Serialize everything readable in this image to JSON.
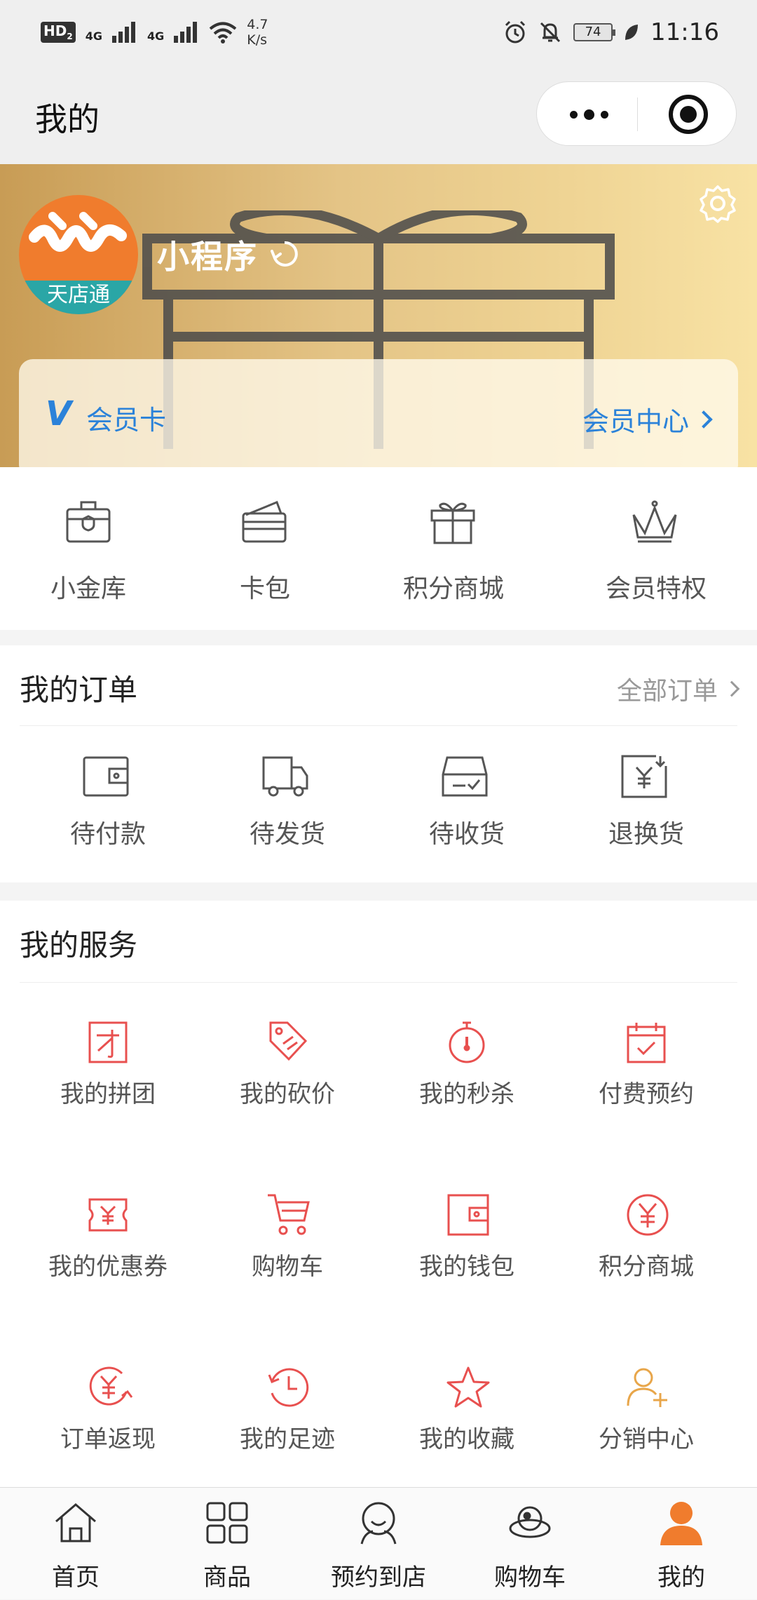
{
  "status_bar": {
    "hd": "HD",
    "sim_index": "2",
    "network_1": "4G",
    "network_2": "4G",
    "speed_value": "4.7",
    "speed_unit": "K/s",
    "battery": "74",
    "time": "11:16"
  },
  "title_bar": {
    "title": "我的"
  },
  "profile": {
    "avatar_brand": "天店通",
    "username": "小程序",
    "member_card_label": "会员卡",
    "member_center_label": "会员中心",
    "colors": {
      "accent_blue": "#2b82d9",
      "banner_gold": "#e4c486"
    }
  },
  "quick_actions": [
    {
      "label": "小金库",
      "icon": "vault-icon"
    },
    {
      "label": "卡包",
      "icon": "card-wallet-icon"
    },
    {
      "label": "积分商城",
      "icon": "gift-box-icon"
    },
    {
      "label": "会员特权",
      "icon": "crown-icon"
    }
  ],
  "orders": {
    "title": "我的订单",
    "all_label": "全部订单",
    "items": [
      {
        "label": "待付款",
        "icon": "wallet-icon"
      },
      {
        "label": "待发货",
        "icon": "delivery-truck-icon"
      },
      {
        "label": "待收货",
        "icon": "inbox-check-icon"
      },
      {
        "label": "退换货",
        "icon": "refund-yen-icon"
      }
    ]
  },
  "services": {
    "title": "我的服务",
    "accent_color": "#e8504f",
    "items": [
      {
        "label": "我的拼团",
        "icon": "group-buy-icon"
      },
      {
        "label": "我的砍价",
        "icon": "price-tag-icon"
      },
      {
        "label": "我的秒杀",
        "icon": "stopwatch-icon"
      },
      {
        "label": "付费预约",
        "icon": "calendar-check-icon"
      },
      {
        "label": "我的优惠券",
        "icon": "coupon-icon"
      },
      {
        "label": "购物车",
        "icon": "cart-icon"
      },
      {
        "label": "我的钱包",
        "icon": "wallet-icon"
      },
      {
        "label": "积分商城",
        "icon": "yen-circle-icon"
      },
      {
        "label": "订单返现",
        "icon": "cashback-icon"
      },
      {
        "label": "我的足迹",
        "icon": "history-icon"
      },
      {
        "label": "我的收藏",
        "icon": "star-icon"
      },
      {
        "label": "分销中心",
        "icon": "add-user-icon"
      }
    ]
  },
  "tab_bar": {
    "active_color": "#f07c2d",
    "items": [
      {
        "label": "首页",
        "icon": "home-icon",
        "active": false
      },
      {
        "label": "商品",
        "icon": "grid-icon",
        "active": false
      },
      {
        "label": "预约到店",
        "icon": "person-icon",
        "active": false
      },
      {
        "label": "购物车",
        "icon": "orbit-person-icon",
        "active": false
      },
      {
        "label": "我的",
        "icon": "user-icon",
        "active": true
      }
    ]
  }
}
